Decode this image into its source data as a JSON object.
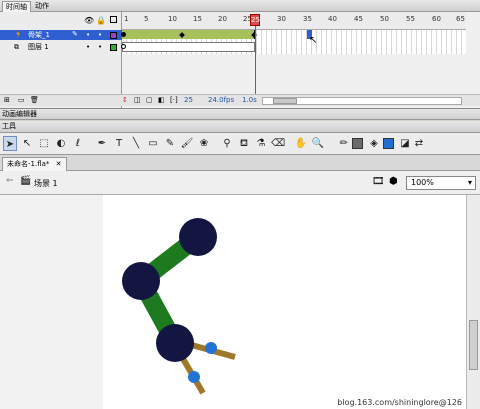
{
  "timeline_tabs": [
    "时间轴",
    "动作"
  ],
  "layers": [
    {
      "name": "骨架_1",
      "selected": true
    },
    {
      "name": "图层 1",
      "selected": false
    }
  ],
  "ruler_labels": [
    "1",
    "5",
    "10",
    "15",
    "20",
    "25",
    "30",
    "35",
    "40",
    "45",
    "50",
    "55",
    "60",
    "65"
  ],
  "playhead_frame": "25",
  "status": {
    "frame": "25",
    "fps": "24.0fps",
    "time": "1.0s"
  },
  "motion_editor_label": "动画编辑器",
  "tools_label": "工具",
  "tool_icons": [
    "arrow-icon",
    "subselect-icon",
    "free-transform-icon",
    "3d-rotation-icon",
    "lasso-icon",
    "pen-icon",
    "text-icon",
    "line-icon",
    "rectangle-icon",
    "pencil-icon",
    "brush-icon",
    "deco-icon",
    "bone-icon",
    "paint-bucket-icon",
    "eyedropper-icon",
    "eraser-icon",
    "hand-icon",
    "zoom-icon"
  ],
  "colors": {
    "stroke": "#6b6b6b",
    "fill": "#1f6fd1",
    "tween": "#a6c05a",
    "joint": "#131640",
    "bone": "#1e7a1e",
    "accent_joint": "#2273d6",
    "stick": "#a0782a"
  },
  "document_tab": "未命名-1.fla*",
  "scene_label": "场景 1",
  "zoom_value": "100%",
  "watermark": "blog.163.com/shininglore@126"
}
